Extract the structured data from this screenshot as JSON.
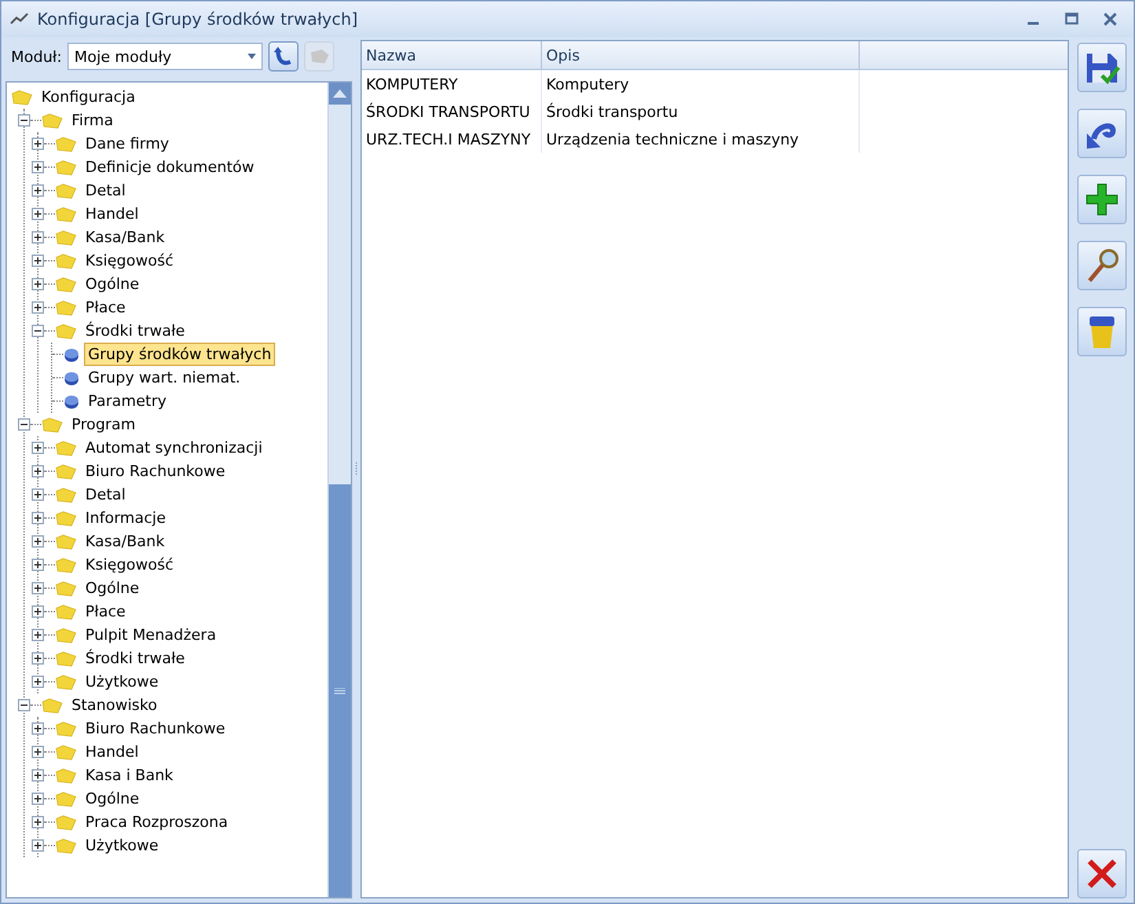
{
  "window": {
    "title": "Konfiguracja [Grupy środków trwałych]"
  },
  "module": {
    "label": "Moduł:",
    "value": "Moje moduły"
  },
  "tree": [
    {
      "label": "Konfiguracja",
      "kind": "folder",
      "selected": false,
      "children": [
        {
          "label": "Firma",
          "kind": "folder",
          "expanded": true,
          "selected": false,
          "children": [
            {
              "label": "Dane firmy",
              "kind": "folder",
              "expanded": false,
              "selected": false
            },
            {
              "label": "Definicje dokumentów",
              "kind": "folder",
              "expanded": false,
              "selected": false
            },
            {
              "label": "Detal",
              "kind": "folder",
              "expanded": false,
              "selected": false
            },
            {
              "label": "Handel",
              "kind": "folder",
              "expanded": false,
              "selected": false
            },
            {
              "label": "Kasa/Bank",
              "kind": "folder",
              "expanded": false,
              "selected": false
            },
            {
              "label": "Księgowość",
              "kind": "folder",
              "expanded": false,
              "selected": false
            },
            {
              "label": "Ogólne",
              "kind": "folder",
              "expanded": false,
              "selected": false
            },
            {
              "label": "Płace",
              "kind": "folder",
              "expanded": false,
              "selected": false
            },
            {
              "label": "Środki trwałe",
              "kind": "folder",
              "expanded": true,
              "selected": false,
              "children": [
                {
                  "label": "Grupy środków trwałych",
                  "kind": "setting",
                  "selected": true
                },
                {
                  "label": "Grupy wart. niemat.",
                  "kind": "setting",
                  "selected": false
                },
                {
                  "label": "Parametry",
                  "kind": "setting",
                  "selected": false
                }
              ]
            }
          ]
        },
        {
          "label": "Program",
          "kind": "folder",
          "expanded": true,
          "selected": false,
          "children": [
            {
              "label": "Automat synchronizacji",
              "kind": "folder",
              "expanded": false,
              "selected": false
            },
            {
              "label": "Biuro Rachunkowe",
              "kind": "folder",
              "expanded": false,
              "selected": false
            },
            {
              "label": "Detal",
              "kind": "folder",
              "expanded": false,
              "selected": false
            },
            {
              "label": "Informacje",
              "kind": "folder",
              "expanded": false,
              "selected": false
            },
            {
              "label": "Kasa/Bank",
              "kind": "folder",
              "expanded": false,
              "selected": false
            },
            {
              "label": "Księgowość",
              "kind": "folder",
              "expanded": false,
              "selected": false
            },
            {
              "label": "Ogólne",
              "kind": "folder",
              "expanded": false,
              "selected": false
            },
            {
              "label": "Płace",
              "kind": "folder",
              "expanded": false,
              "selected": false
            },
            {
              "label": "Pulpit Menadżera",
              "kind": "folder",
              "expanded": false,
              "selected": false
            },
            {
              "label": "Środki trwałe",
              "kind": "folder",
              "expanded": false,
              "selected": false
            },
            {
              "label": "Użytkowe",
              "kind": "folder",
              "expanded": false,
              "selected": false
            }
          ]
        },
        {
          "label": "Stanowisko",
          "kind": "folder",
          "expanded": true,
          "selected": false,
          "children": [
            {
              "label": "Biuro Rachunkowe",
              "kind": "folder",
              "expanded": false,
              "selected": false
            },
            {
              "label": "Handel",
              "kind": "folder",
              "expanded": false,
              "selected": false
            },
            {
              "label": "Kasa i Bank",
              "kind": "folder",
              "expanded": false,
              "selected": false
            },
            {
              "label": "Ogólne",
              "kind": "folder",
              "expanded": false,
              "selected": false
            },
            {
              "label": "Praca Rozproszona",
              "kind": "folder",
              "expanded": false,
              "selected": false
            },
            {
              "label": "Użytkowe",
              "kind": "folder",
              "expanded": false,
              "selected": false
            }
          ]
        }
      ]
    }
  ],
  "table": {
    "columns": [
      "Nazwa",
      "Opis"
    ],
    "rows": [
      [
        "KOMPUTERY",
        "Komputery"
      ],
      [
        "ŚRODKI TRANSPORTU",
        "Środki transportu"
      ],
      [
        "URZ.TECH.I MASZYNY",
        "Urządzenia techniczne i maszyny"
      ]
    ]
  },
  "toolbar": [
    {
      "kind": "save"
    },
    {
      "kind": "undo"
    },
    {
      "kind": "add"
    },
    {
      "kind": "search"
    },
    {
      "kind": "delete"
    }
  ]
}
